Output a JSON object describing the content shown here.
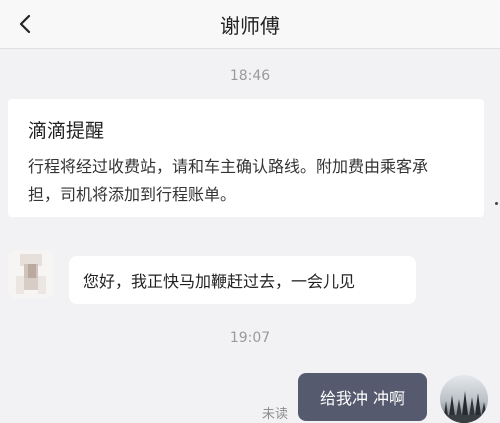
{
  "header": {
    "title": "谢师傅",
    "back_icon": "chevron-left-icon"
  },
  "messages": {
    "time_1": "18:46",
    "notice": {
      "title": "滴滴提醒",
      "line_1": "行程将经过收费站，请和车主确认路线。附加费由乘客承",
      "line_2": "担，司机将添加到行程账单。"
    },
    "driver_message": "您好，我正快马加鞭赶过去，一会儿见",
    "time_2": "19:07",
    "my_message": "给我冲 冲啊",
    "my_message_status": "未读"
  },
  "colors": {
    "background": "#f2f2f4",
    "header_background": "#f8f8f8",
    "card_background": "#ffffff",
    "sent_bubble": "#565a6e",
    "timestamp_text": "#9a9a9a"
  }
}
